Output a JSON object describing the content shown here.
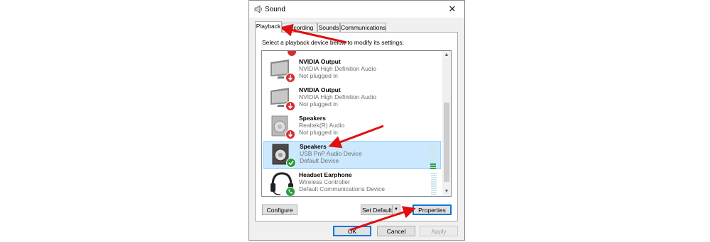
{
  "window": {
    "title": "Sound",
    "close_glyph": "✕"
  },
  "tabs": [
    {
      "label": "Playback",
      "active": true
    },
    {
      "label": "Recording",
      "active": false
    },
    {
      "label": "Sounds",
      "active": false
    },
    {
      "label": "Communications",
      "active": false
    }
  ],
  "instruction": "Select a playback device below to modify its settings:",
  "devices": [
    {
      "name": "NVIDIA Output",
      "driver": "NVIDIA High Definition Audio",
      "status": "Not plugged in",
      "icon": "monitor-icon",
      "badge": "unplugged-badge-icon",
      "selected": false
    },
    {
      "name": "NVIDIA Output",
      "driver": "NVIDIA High Definition Audio",
      "status": "Not plugged in",
      "icon": "monitor-icon",
      "badge": "unplugged-badge-icon",
      "selected": false
    },
    {
      "name": "Speakers",
      "driver": "Realtek(R) Audio",
      "status": "Not plugged in",
      "icon": "speaker-icon",
      "badge": "unplugged-badge-icon",
      "selected": false
    },
    {
      "name": "Speakers",
      "driver": "USB PnP Audio Device",
      "status": "Default Device",
      "icon": "speaker-icon",
      "badge": "default-check-icon",
      "selected": true,
      "meter_level": 0.25
    },
    {
      "name": "Headset Earphone",
      "driver": "Wireless Controller",
      "status": "Default Communications Device",
      "icon": "headset-icon",
      "badge": "phone-badge-icon",
      "selected": false,
      "meter_level": 0
    }
  ],
  "buttons": {
    "configure": "Configure",
    "set_default": "Set Default",
    "properties": "Properties",
    "ok": "OK",
    "cancel": "Cancel",
    "apply": "Apply"
  },
  "colors": {
    "selection": "#cce8ff",
    "annotation_arrow": "#e01010",
    "unplugged_badge": "#d32f2f",
    "default_badge": "#2e9a3e",
    "focus_border": "#0078d7"
  }
}
